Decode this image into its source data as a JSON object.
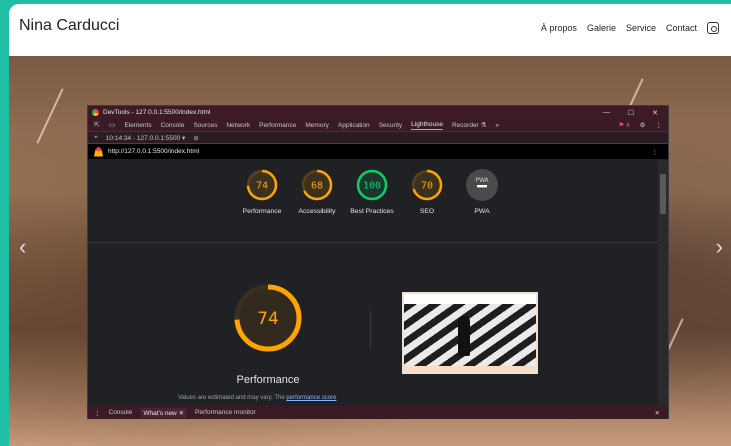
{
  "site": {
    "title": "Nina Carducci",
    "nav": [
      "À propos",
      "Galerie",
      "Service",
      "Contact"
    ]
  },
  "devtools": {
    "window_title": "DevTools - 127.0.0.1:5500/index.html",
    "tabs": [
      "Elements",
      "Console",
      "Sources",
      "Network",
      "Performance",
      "Memory",
      "Application",
      "Security",
      "Lighthouse",
      "Recorder ⚗",
      "»"
    ],
    "active_tab": "Lighthouse",
    "issues_count": "4",
    "report_time": "10:14:34 - 127.0.0.1:5500 ▾",
    "url": "http://127.0.0.1:5500/index.html",
    "scores": [
      {
        "label": "Performance",
        "value": 74,
        "color": "#ffa400"
      },
      {
        "label": "Accessibility",
        "value": 68,
        "color": "#ffa400"
      },
      {
        "label": "Best Practices",
        "value": 100,
        "color": "#0cce6b"
      },
      {
        "label": "SEO",
        "value": 70,
        "color": "#ffa400"
      },
      {
        "label": "PWA",
        "value": "PWA",
        "color": "#9aa0a6"
      }
    ],
    "performance": {
      "score": 74,
      "label": "Performance",
      "note": "Values are estimated and may vary. The ",
      "note_link": "performance score"
    },
    "drawer": {
      "tabs": [
        "Console",
        "What's new",
        "Performance monitor"
      ],
      "active": "What's new"
    }
  }
}
